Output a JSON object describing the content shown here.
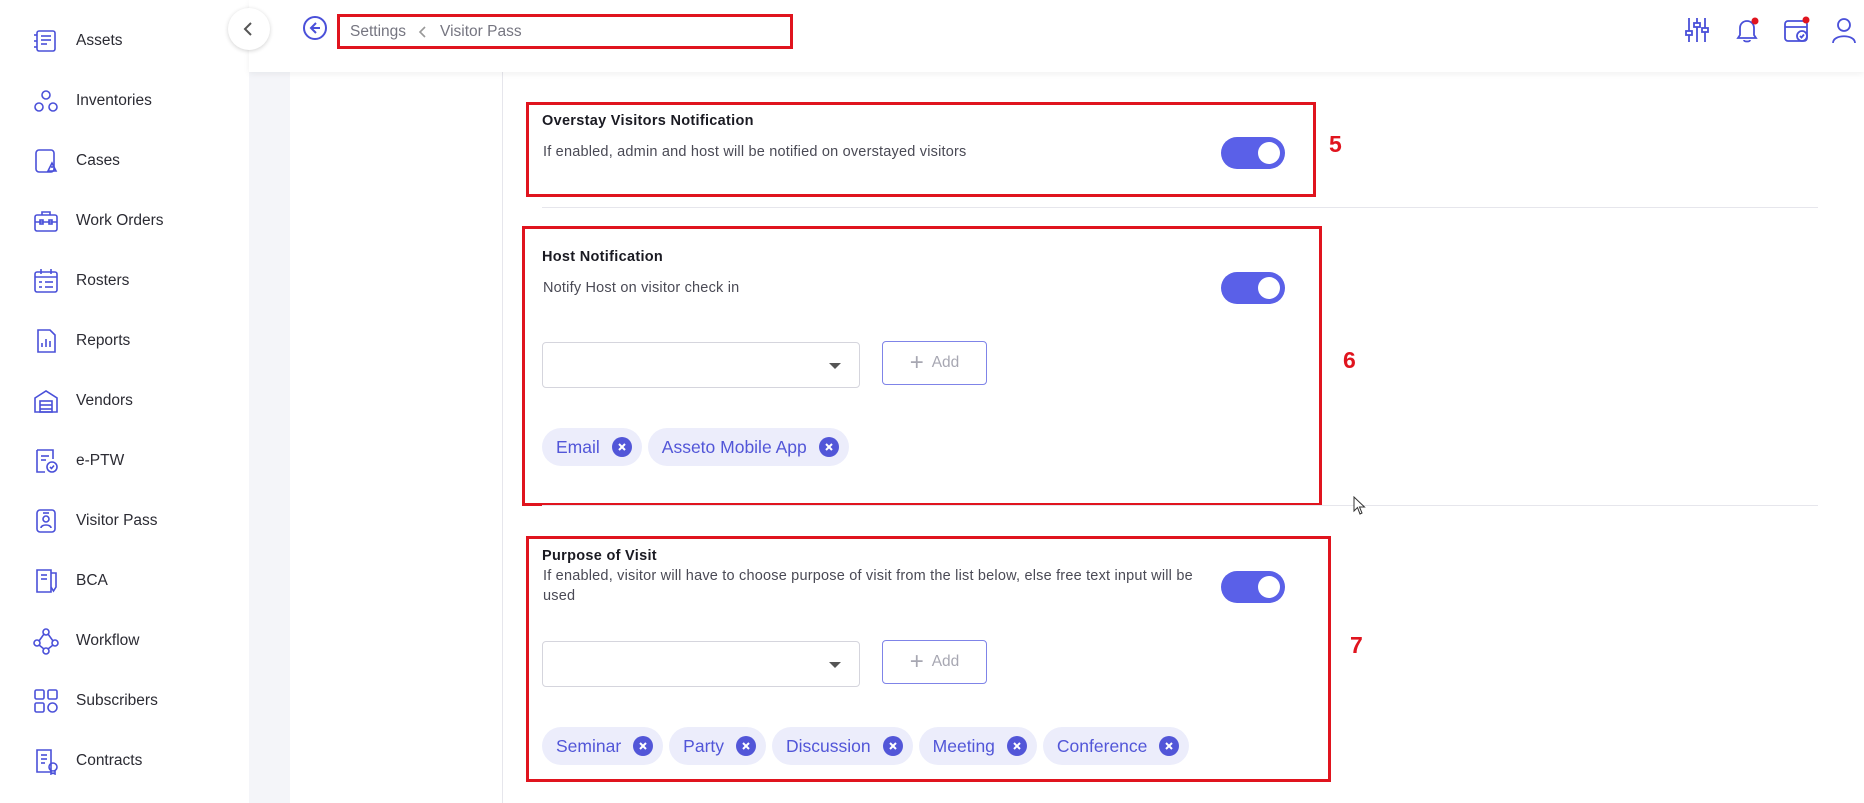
{
  "sidebar": {
    "items": [
      {
        "label": "Assets",
        "icon": "assets-icon"
      },
      {
        "label": "Inventories",
        "icon": "inventories-icon"
      },
      {
        "label": "Cases",
        "icon": "cases-icon"
      },
      {
        "label": "Work Orders",
        "icon": "work-orders-icon"
      },
      {
        "label": "Rosters",
        "icon": "rosters-icon"
      },
      {
        "label": "Reports",
        "icon": "reports-icon"
      },
      {
        "label": "Vendors",
        "icon": "vendors-icon"
      },
      {
        "label": "e-PTW",
        "icon": "eptw-icon"
      },
      {
        "label": "Visitor Pass",
        "icon": "visitor-pass-icon"
      },
      {
        "label": "BCA",
        "icon": "bca-icon"
      },
      {
        "label": "Workflow",
        "icon": "workflow-icon"
      },
      {
        "label": "Subscribers",
        "icon": "subscribers-icon"
      },
      {
        "label": "Contracts",
        "icon": "contracts-icon"
      }
    ]
  },
  "header": {
    "breadcrumb": {
      "parent": "Settings",
      "current": "Visitor Pass"
    },
    "icons": [
      "filter-sliders-icon",
      "notification-bell-icon",
      "calendar-check-icon",
      "user-profile-icon"
    ]
  },
  "sections": {
    "overstay": {
      "title": "Overstay Visitors Notification",
      "description": "If enabled, admin and host will be notified on overstayed visitors",
      "enabled": true,
      "annotation": "5"
    },
    "host": {
      "title": "Host Notification",
      "description": "Notify Host on visitor check in",
      "enabled": true,
      "select_value": "",
      "add_label": "Add",
      "chips": [
        "Email",
        "Asseto Mobile App"
      ],
      "annotation": "6"
    },
    "purpose": {
      "title": "Purpose of Visit",
      "description": "If enabled, visitor will have to choose purpose of visit from the list below, else free text input will be used",
      "enabled": true,
      "select_value": "",
      "add_label": "Add",
      "chips": [
        "Seminar",
        "Party",
        "Discussion",
        "Meeting",
        "Conference"
      ],
      "annotation": "7"
    }
  },
  "colors": {
    "accent": "#5a60e8",
    "annotation": "#e0141e",
    "chip_bg": "#ecedfb"
  }
}
